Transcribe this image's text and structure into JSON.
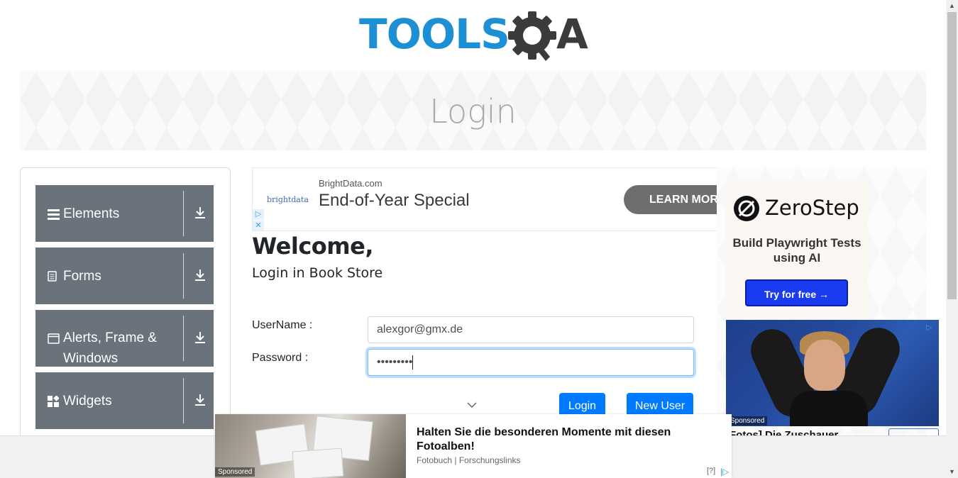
{
  "logo": {
    "text": "TOOLS",
    "suffix": "A",
    "brand_blue": "#1d8fd4",
    "brand_dark": "#3b3b3b"
  },
  "banner": {
    "title": "Login"
  },
  "sidebar": {
    "groups": [
      {
        "label": "Elements",
        "icon": "menu-lines-icon"
      },
      {
        "label": "Forms",
        "icon": "document-icon"
      },
      {
        "label": "Alerts, Frame & Windows",
        "icon": "window-icon"
      },
      {
        "label": "Widgets",
        "icon": "widgets-icon"
      }
    ],
    "group_color": "#6a727b"
  },
  "ad_top": {
    "brand_logo": "brightdata",
    "domain": "BrightData.com",
    "headline": "End-of-Year Special",
    "cta": "LEARN MORE",
    "marks": [
      "▷",
      "✕"
    ]
  },
  "main": {
    "welcome": "Welcome,",
    "subheading": "Login in Book Store",
    "username_label": "UserName :",
    "username_value": "alexgor@gmx.de",
    "password_label": "Password :",
    "password_value": "•••••••••",
    "login_button": "Login",
    "new_user_button": "New User",
    "accent": "#007bff"
  },
  "right_ad": {
    "brand": "ZeroStep",
    "text": "Build Playwright Tests using AI",
    "cta": "Try for free →",
    "photo_sponsored": "Sponsored",
    "photo_title": "Fotos] Die Zuschauer",
    "adchoice": "▷"
  },
  "bottom_ad": {
    "sponsored": "Sponsored",
    "title": "Halten Sie die besonderen Momente mit diesen Fotoalben!",
    "subtitle": "Fotobuch | Forschungslinks",
    "help": "[?]",
    "choice": "|▷"
  }
}
